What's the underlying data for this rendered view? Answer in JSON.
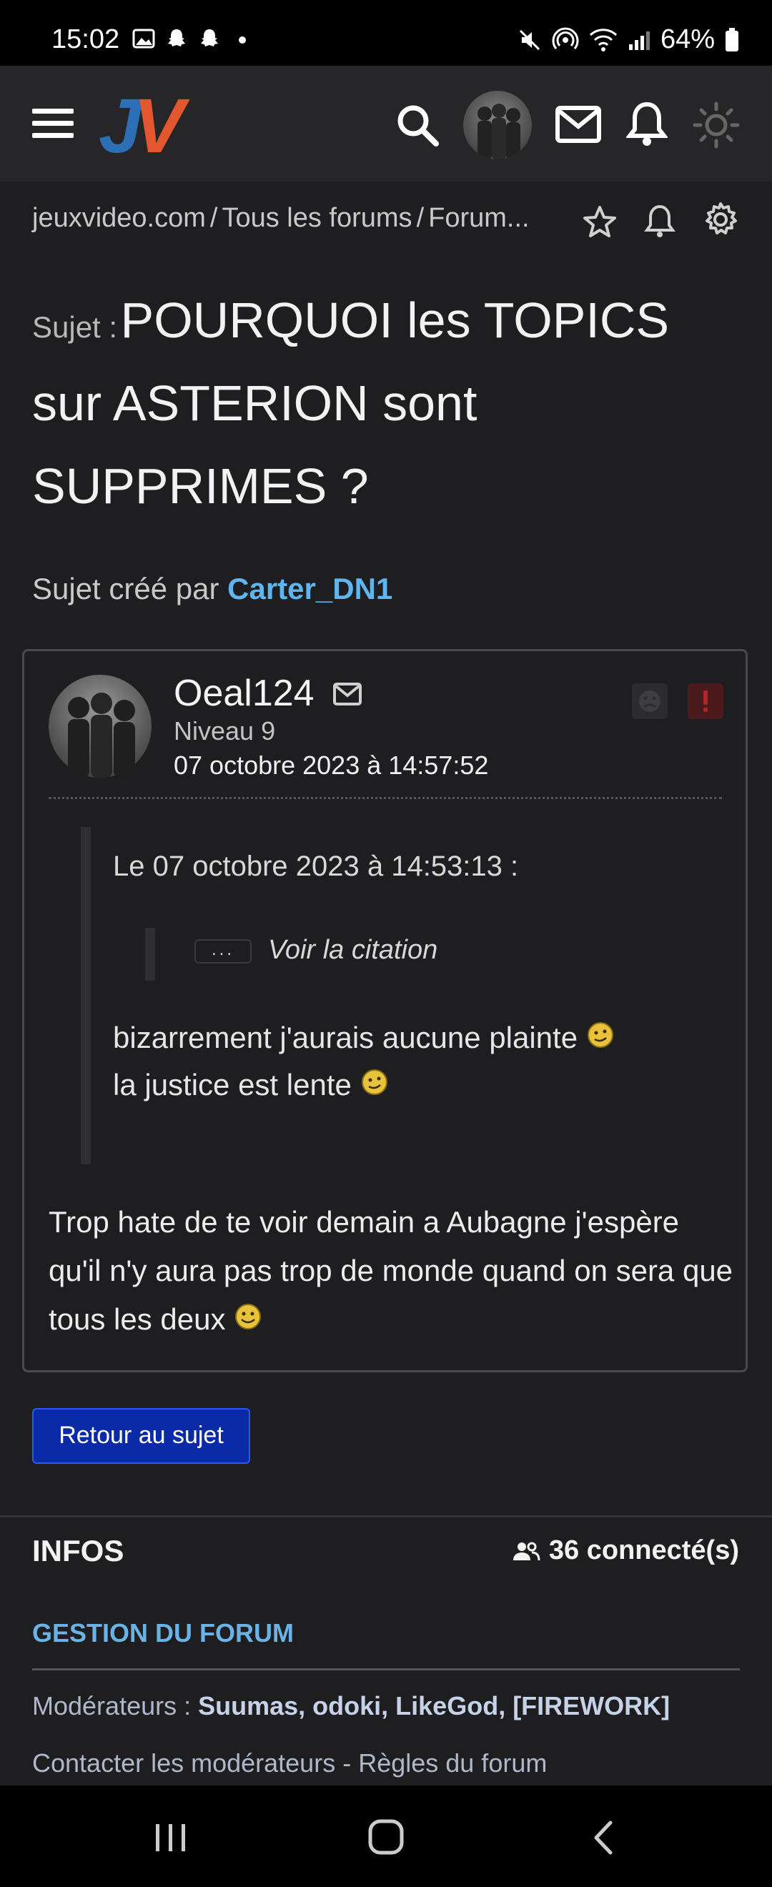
{
  "status_bar": {
    "time": "15:02",
    "battery": "64%",
    "left_icons": [
      "image-icon",
      "snapchat-icon",
      "snapchat-icon",
      "dot-icon"
    ],
    "right_icons": [
      "mute-icon",
      "hotspot-icon",
      "wifi-icon",
      "signal-icon",
      "battery-icon"
    ]
  },
  "header": {
    "logo_j": "J",
    "logo_v": "V",
    "icons": [
      "menu-icon",
      "search-icon",
      "avatar",
      "mail-icon",
      "bell-icon",
      "theme-icon"
    ]
  },
  "breadcrumb": {
    "items": [
      "jeuxvideo.com",
      "Tous les forums",
      "Forum..."
    ],
    "separator": "/"
  },
  "topic": {
    "label": "Sujet :",
    "title": "POURQUOI les TOPICS sur ASTERION sont SUPPRIMES ?",
    "created_by_label": "Sujet créé par",
    "creator": "Carter_DN1"
  },
  "post": {
    "author": "Oeal124",
    "level": "Niveau 9",
    "date": "07 octobre 2023 à 14:57:52",
    "quote": {
      "header": "Le 07 octobre 2023 à 14:53:13 :",
      "dots": "...",
      "voir_label": "Voir la citation",
      "line1": "bizarrement j'aurais aucune plainte",
      "line2": "la justice est lente"
    },
    "body": "Trop hate de te voir demain a Aubagne j'espère qu'il n'y aura pas trop de monde quand on sera que tous les deux"
  },
  "retour_button": "Retour au sujet",
  "infos": {
    "title": "INFOS",
    "connected": "36 connecté(s)",
    "gestion": "GESTION DU FORUM",
    "moderators_label": "Modérateurs :",
    "moderators": "Suumas, odoki, LikeGod, [FIREWORK]",
    "contact": "Contacter les modérateurs",
    "contact_sep": " - ",
    "rules": "Règles du forum"
  },
  "colors": {
    "background": "#1e1e20",
    "link_blue": "#5fb6ee",
    "button_blue": "#0a2aa8",
    "logo_blue": "#2d6fb7",
    "logo_orange": "#e4572e"
  }
}
